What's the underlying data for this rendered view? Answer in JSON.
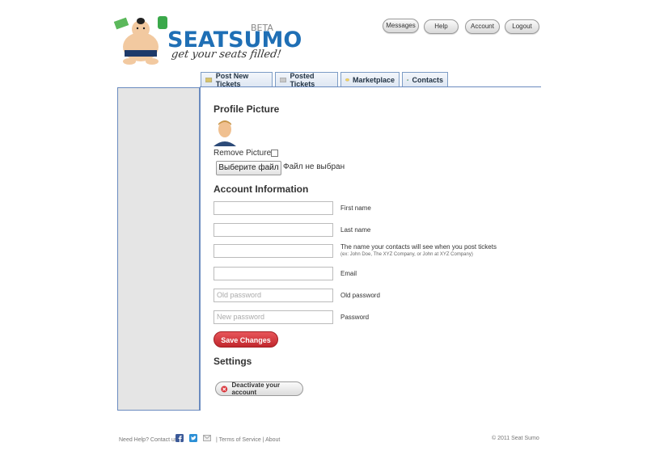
{
  "logo": {
    "name": "SEATSUMO",
    "beta": "BETA",
    "tagline": "get your seats filled!"
  },
  "top_nav": {
    "messages": "Messages",
    "help": "Help",
    "account": "Account",
    "logout": "Logout"
  },
  "tabs": [
    {
      "label": "Post New Tickets"
    },
    {
      "label": "Posted Tickets"
    },
    {
      "label": "Marketplace"
    },
    {
      "label": "Contacts"
    }
  ],
  "profile": {
    "heading": "Profile Picture",
    "remove_label": "Remove Picture",
    "file_button": "Выберите файл",
    "file_status": "Файл не выбран"
  },
  "account": {
    "heading": "Account Information",
    "first_name_label": "First name",
    "last_name_label": "Last name",
    "display_name_label": "The name your contacts will see when you post tickets",
    "display_name_hint": "(ex: John Doe, The XYZ Company, or John at XYZ Company)",
    "email_label": "Email",
    "old_password_placeholder": "Old password",
    "old_password_label": "Old password",
    "new_password_placeholder": "New password",
    "password_label": "Password",
    "save_button": "Save Changes"
  },
  "settings": {
    "heading": "Settings",
    "deactivate_button": "Deactivate your account"
  },
  "footer": {
    "help_text": "Need Help? Contact us:",
    "links": "| Terms of Service | About",
    "copyright": "© 2011 Seat Sumo"
  }
}
